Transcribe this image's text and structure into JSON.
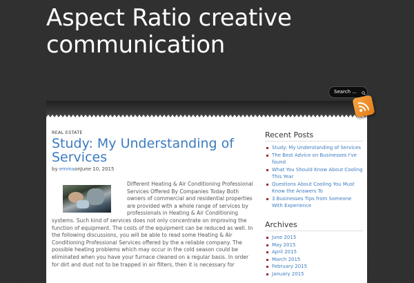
{
  "site": {
    "title": "Aspect Ratio creative communication"
  },
  "search": {
    "placeholder": "Search ..."
  },
  "post": {
    "category": "REAL ESTATE",
    "title": "Study: My Understanding of Services",
    "byline_prefix": "by",
    "author": "emma",
    "on_text": "on",
    "date": "June 10, 2015",
    "body": "Different Heating & Air Conditioning Professional Services Offered By Companies Today Both owners of commercial and residential properties are provided with a whole range of services by professionals in Heating & Air Conditioning systems. Such kind of services does not only concentrate on improving the function of equipment. The costs of the equipment can be reduced as well. In the following discussions, you will be able to read some Heating & Air Conditioning Professional Services offered by the a reliable company. The possible heating problems which may occur in the cold season could be eliminated when you have your furnace cleaned on a regular basis. In order for dirt and dust not to be trapped in air filters, then it is necessary for"
  },
  "sidebar": {
    "recent_title": "Recent Posts",
    "recent_posts": [
      "Study: My Understanding of Services",
      "The Best Advice on Businesses I've found",
      "What You Should Know About Cooling This Year",
      "Questions About Cooling You Must Know the Answers To",
      "3 Businesses Tips from Someone With Experience"
    ],
    "archives_title": "Archives",
    "archives": [
      "June 2015",
      "May 2015",
      "April 2015",
      "March 2015",
      "February 2015",
      "January 2015"
    ]
  },
  "colors": {
    "background": "#2f2f2f",
    "link": "#3b7bbf",
    "rss": "#f28c28",
    "bullet": "#9c2b2b"
  },
  "icons": {
    "feed": "rss-icon",
    "search": "search-icon"
  }
}
